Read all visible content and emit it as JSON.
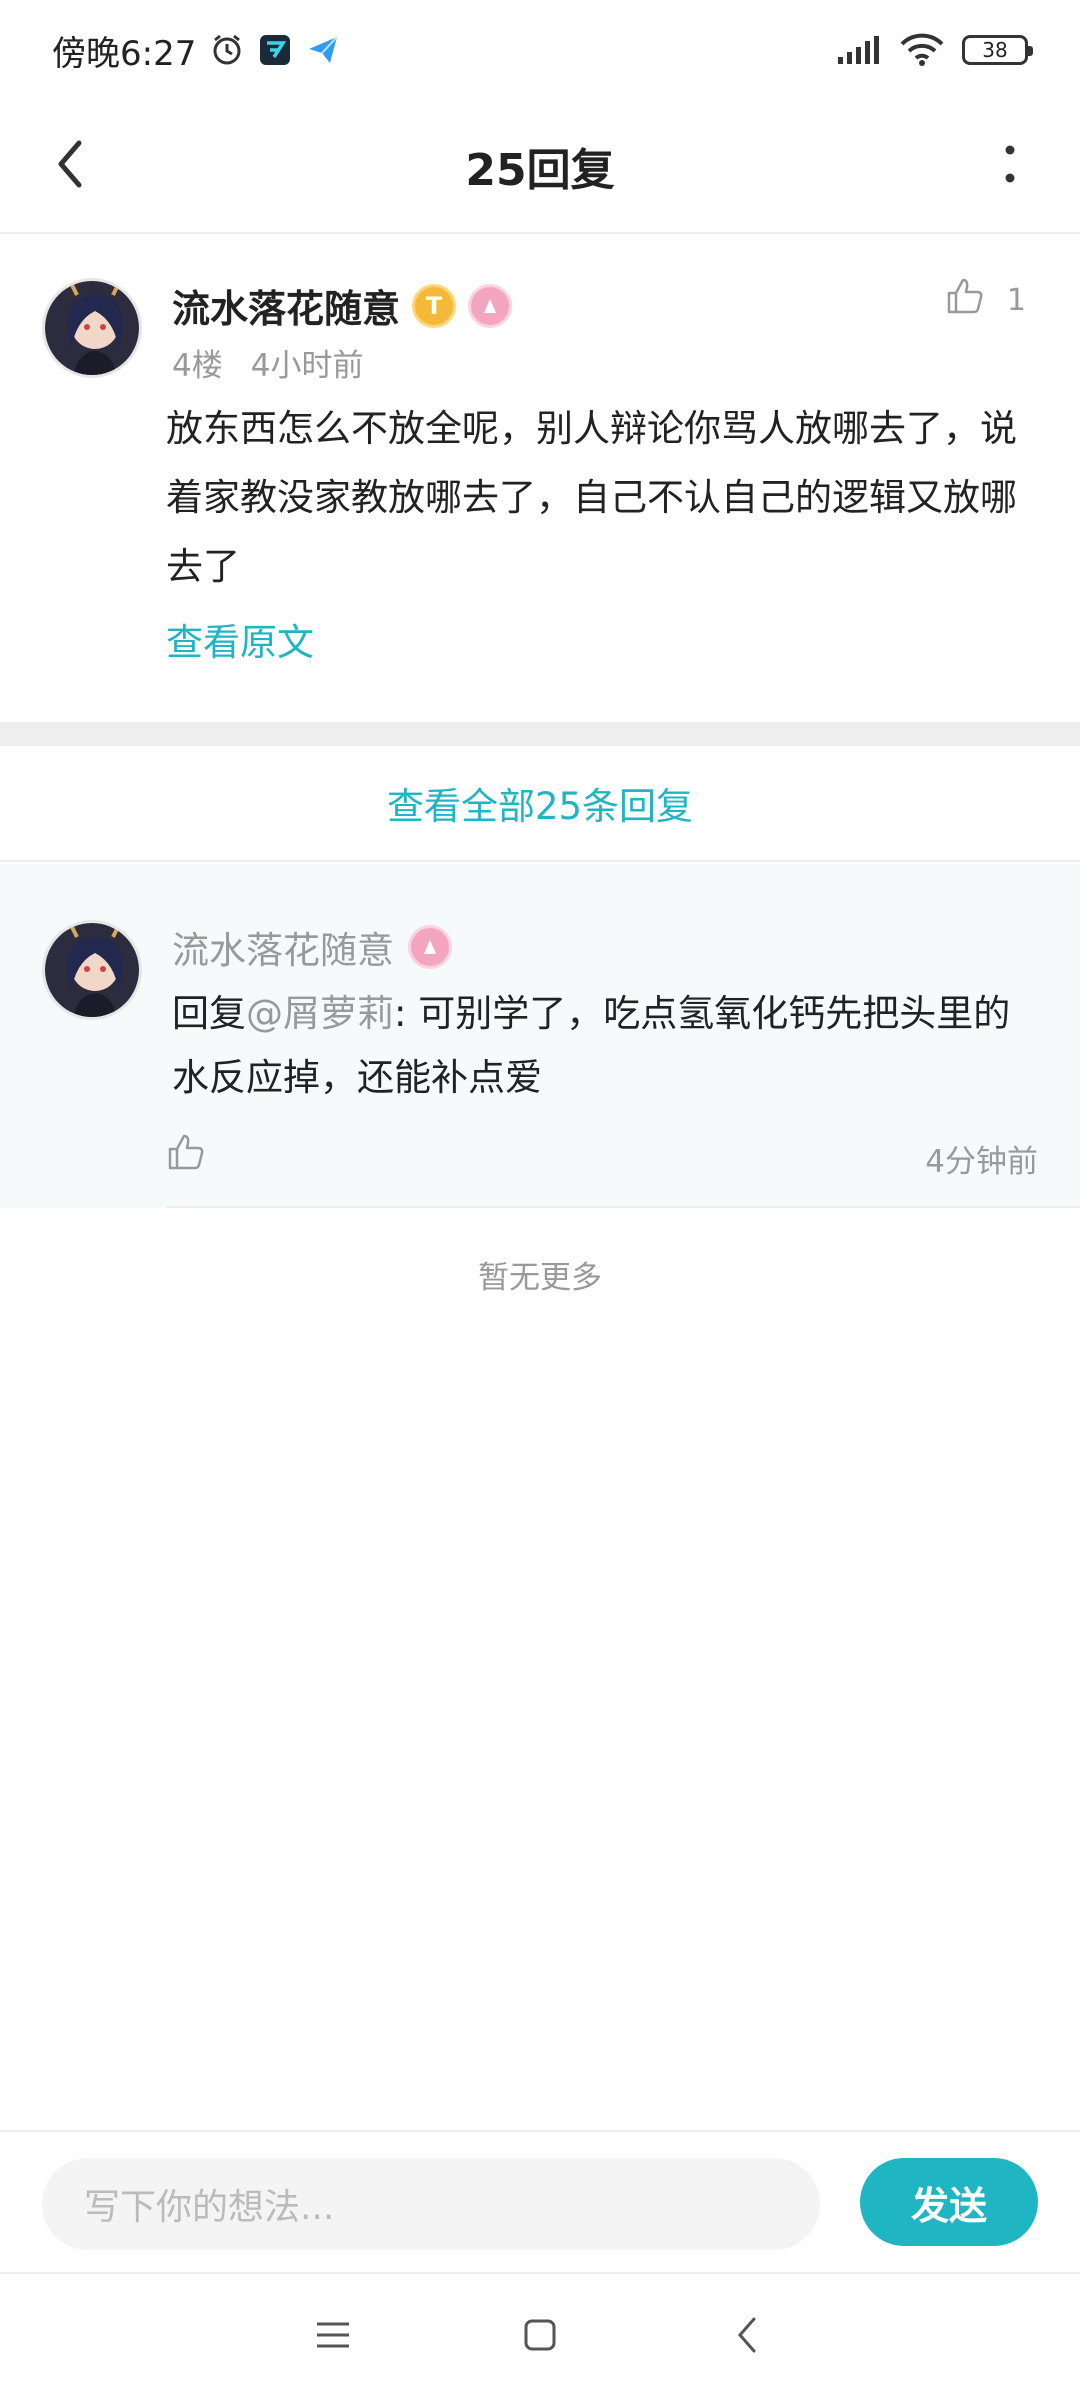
{
  "status_bar": {
    "time": "傍晚6:27",
    "battery": "38",
    "icons": [
      "alarm-icon",
      "app-icon",
      "send-icon",
      "signal-icon",
      "wifi-icon",
      "battery-icon"
    ]
  },
  "header": {
    "title": "25回复",
    "back_icon": "chevron-left-icon",
    "more_icon": "more-vertical-icon"
  },
  "main_comment": {
    "username": "流水落花随意",
    "badges": [
      "gold-badge-icon",
      "pink-badge-icon"
    ],
    "floor": "4楼",
    "time": "4小时前",
    "like_count": "1",
    "content": "放东西怎么不放全呢，别人辩论你骂人放哪去了，说着家教没家教放哪去了，自己不认自己的逻辑又放哪去了",
    "view_original": "查看原文"
  },
  "view_all_replies": "查看全部25条回复",
  "reply": {
    "username": "流水落花随意",
    "prefix": "回复",
    "mention": "@屑萝莉",
    "content": ": 可别学了，吃点氢氧化钙先把头里的水反应掉，还能补点爱",
    "time": "4分钟前"
  },
  "no_more": "暂无更多",
  "input": {
    "placeholder": "写下你的想法...",
    "send_label": "发送"
  },
  "colors": {
    "accent": "#1fb5c3",
    "muted_text": "#999999",
    "divider": "#eeeeee"
  }
}
